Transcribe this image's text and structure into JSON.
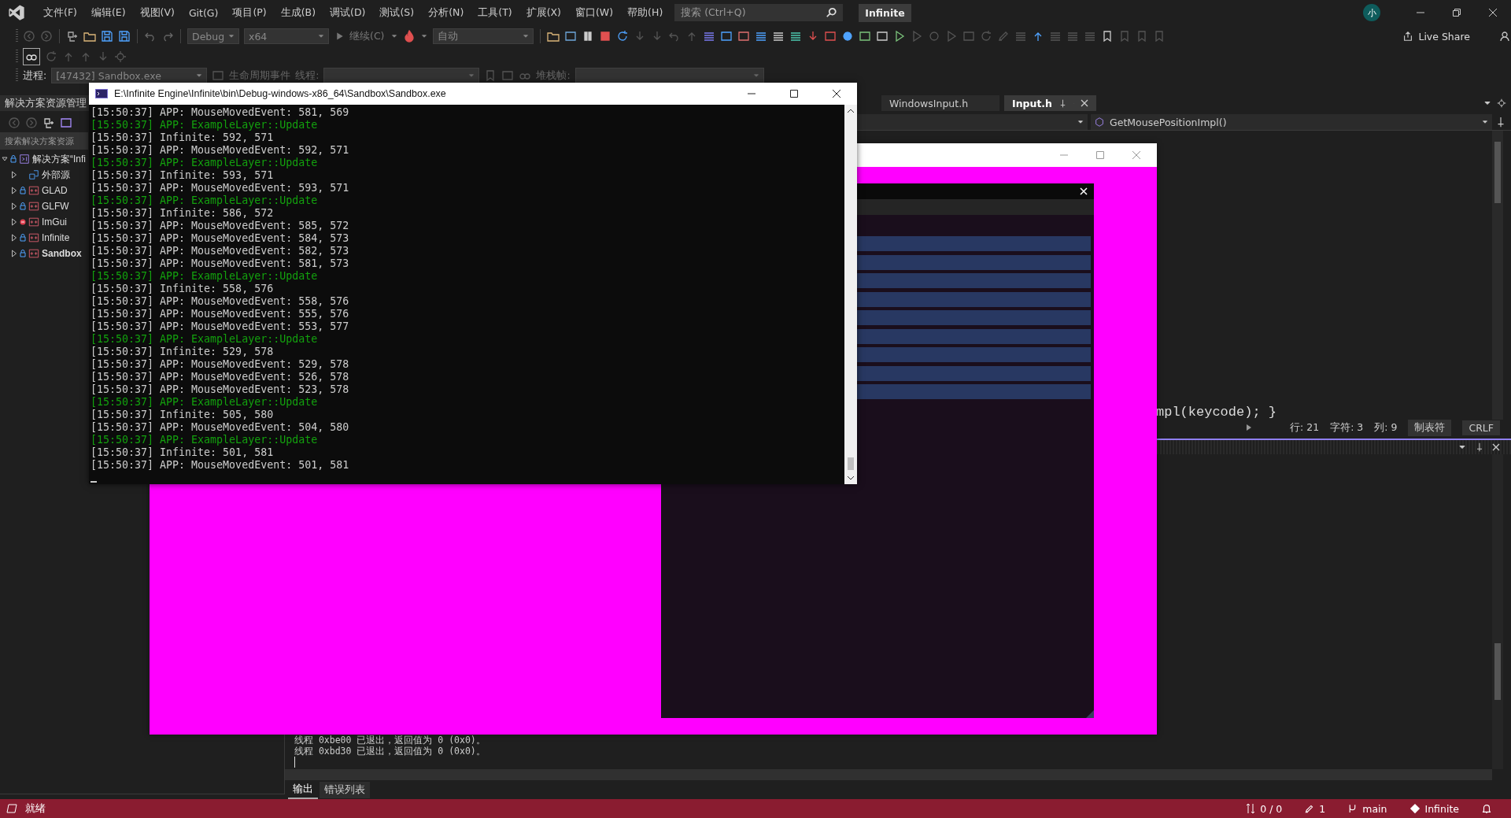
{
  "menu": [
    "文件(F)",
    "编辑(E)",
    "视图(V)",
    "Git(G)",
    "项目(P)",
    "生成(B)",
    "调试(D)",
    "测试(S)",
    "分析(N)",
    "工具(T)",
    "扩展(X)",
    "窗口(W)",
    "帮助(H)"
  ],
  "search": {
    "placeholder": "搜索 (Ctrl+Q)"
  },
  "solution_name": "Infinite",
  "account": {
    "initial": "小"
  },
  "toolbar": {
    "configuration": "Debug",
    "platform": "x64",
    "continue": "继续(C)",
    "target": "自动",
    "live_share": "Live Share"
  },
  "debug_location": {
    "process_label": "进程:",
    "process": "[47432] Sandbox.exe",
    "lifecycle": "生命周期事件",
    "thread_label": "线程:",
    "stack_label": "堆栈帧:"
  },
  "solution_explorer": {
    "title": "解决方案资源管理",
    "search_placeholder": "搜索解决方案资源",
    "items": [
      {
        "label": "解决方案“Infi",
        "kind": "solution",
        "locked": true,
        "excluded": false,
        "startup": false,
        "expanded": true,
        "children": [
          {
            "label": "外部源",
            "kind": "external",
            "locked": false,
            "excluded": false,
            "startup": false,
            "expanded": false
          },
          {
            "label": "GLAD",
            "kind": "project",
            "locked": true,
            "excluded": false,
            "startup": false,
            "expanded": false
          },
          {
            "label": "GLFW",
            "kind": "project",
            "locked": true,
            "excluded": false,
            "startup": false,
            "expanded": false
          },
          {
            "label": "ImGui",
            "kind": "project",
            "locked": false,
            "excluded": true,
            "startup": false,
            "expanded": false
          },
          {
            "label": "Infinite",
            "kind": "project",
            "locked": true,
            "excluded": false,
            "startup": false,
            "expanded": false
          },
          {
            "label": "Sandbox",
            "kind": "project",
            "locked": true,
            "excluded": false,
            "startup": true,
            "expanded": false
          }
        ]
      }
    ]
  },
  "documents": [
    {
      "label": "WindowsInput.h",
      "selected": false
    },
    {
      "label": "Input.h",
      "selected": true
    }
  ],
  "navigation": {
    "member": "GetMousePositionImpl()"
  },
  "code_lines": [
    "mpl(keycode); }"
  ],
  "editor_status": [
    "行: 21",
    "字符: 3",
    "列: 9",
    "制表符",
    "CRLF"
  ],
  "output": {
    "lines": [
      "线程 0xbe00 已退出，返回值为 0 (0x0)。",
      "线程 0xbd30 已退出，返回值为 0 (0x0)。"
    ],
    "tabs": [
      {
        "label": "输出",
        "selected": true
      },
      {
        "label": "错误列表",
        "selected": false
      }
    ]
  },
  "status_bar": {
    "ready": "就绪",
    "changes": "0 / 0",
    "edits": "1",
    "branch": "main",
    "repo": "Infinite"
  },
  "console": {
    "title": "E:\\Infinite Engine\\Infinite\\bin\\Debug-windows-x86_64\\Sandbox\\Sandbox.exe",
    "lines": [
      {
        "text": "[15:50:37] APP: MouseMovedEvent: 581, 569",
        "color": "#cccccc"
      },
      {
        "text": "[15:50:37] APP: ExampleLayer::Update",
        "color": "#13a10e"
      },
      {
        "text": "[15:50:37] Infinite: 592, 571",
        "color": "#cccccc"
      },
      {
        "text": "[15:50:37] APP: MouseMovedEvent: 592, 571",
        "color": "#cccccc"
      },
      {
        "text": "[15:50:37] APP: ExampleLayer::Update",
        "color": "#13a10e"
      },
      {
        "text": "[15:50:37] Infinite: 593, 571",
        "color": "#cccccc"
      },
      {
        "text": "[15:50:37] APP: MouseMovedEvent: 593, 571",
        "color": "#cccccc"
      },
      {
        "text": "[15:50:37] APP: ExampleLayer::Update",
        "color": "#13a10e"
      },
      {
        "text": "[15:50:37] Infinite: 586, 572",
        "color": "#cccccc"
      },
      {
        "text": "[15:50:37] APP: MouseMovedEvent: 585, 572",
        "color": "#cccccc"
      },
      {
        "text": "[15:50:37] APP: MouseMovedEvent: 584, 573",
        "color": "#cccccc"
      },
      {
        "text": "[15:50:37] APP: MouseMovedEvent: 582, 573",
        "color": "#cccccc"
      },
      {
        "text": "[15:50:37] APP: MouseMovedEvent: 581, 573",
        "color": "#cccccc"
      },
      {
        "text": "[15:50:37] APP: ExampleLayer::Update",
        "color": "#13a10e"
      },
      {
        "text": "[15:50:37] Infinite: 558, 576",
        "color": "#cccccc"
      },
      {
        "text": "[15:50:37] APP: MouseMovedEvent: 558, 576",
        "color": "#cccccc"
      },
      {
        "text": "[15:50:37] APP: MouseMovedEvent: 555, 576",
        "color": "#cccccc"
      },
      {
        "text": "[15:50:37] APP: MouseMovedEvent: 553, 577",
        "color": "#cccccc"
      },
      {
        "text": "[15:50:37] APP: ExampleLayer::Update",
        "color": "#13a10e"
      },
      {
        "text": "[15:50:37] Infinite: 529, 578",
        "color": "#cccccc"
      },
      {
        "text": "[15:50:37] APP: MouseMovedEvent: 529, 578",
        "color": "#cccccc"
      },
      {
        "text": "[15:50:37] APP: MouseMovedEvent: 526, 578",
        "color": "#cccccc"
      },
      {
        "text": "[15:50:37] APP: MouseMovedEvent: 523, 578",
        "color": "#cccccc"
      },
      {
        "text": "[15:50:37] APP: ExampleLayer::Update",
        "color": "#13a10e"
      },
      {
        "text": "[15:50:37] Infinite: 505, 580",
        "color": "#cccccc"
      },
      {
        "text": "[15:50:37] APP: MouseMovedEvent: 504, 580",
        "color": "#cccccc"
      },
      {
        "text": "[15:50:37] APP: ExampleLayer::Update",
        "color": "#13a10e"
      },
      {
        "text": "[15:50:37] Infinite: 501, 581",
        "color": "#cccccc"
      },
      {
        "text": "[15:50:37] APP: MouseMovedEvent: 501, 581",
        "color": "#cccccc"
      }
    ]
  }
}
